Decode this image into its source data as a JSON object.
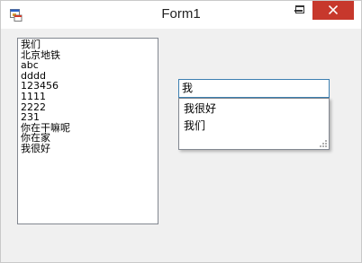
{
  "window": {
    "title": "Form1"
  },
  "listbox": {
    "items": [
      "我们",
      "北京地铁",
      "abc",
      "dddd",
      "123456",
      "1111",
      "2222",
      "231",
      "你在干嘛呢",
      "你在家",
      "我很好"
    ]
  },
  "textbox": {
    "value": "我"
  },
  "suggestions": {
    "items": [
      "我很好",
      "我们"
    ]
  },
  "icons": {
    "app": "form-icon",
    "minimize": "minimize-icon",
    "maximize": "maximize-icon",
    "close": "close-icon",
    "grip": "resize-grip-icon"
  },
  "colors": {
    "close_button": "#c7382c",
    "textbox_focus_border": "#3c7fb1",
    "client_background": "#f0f0f0"
  }
}
